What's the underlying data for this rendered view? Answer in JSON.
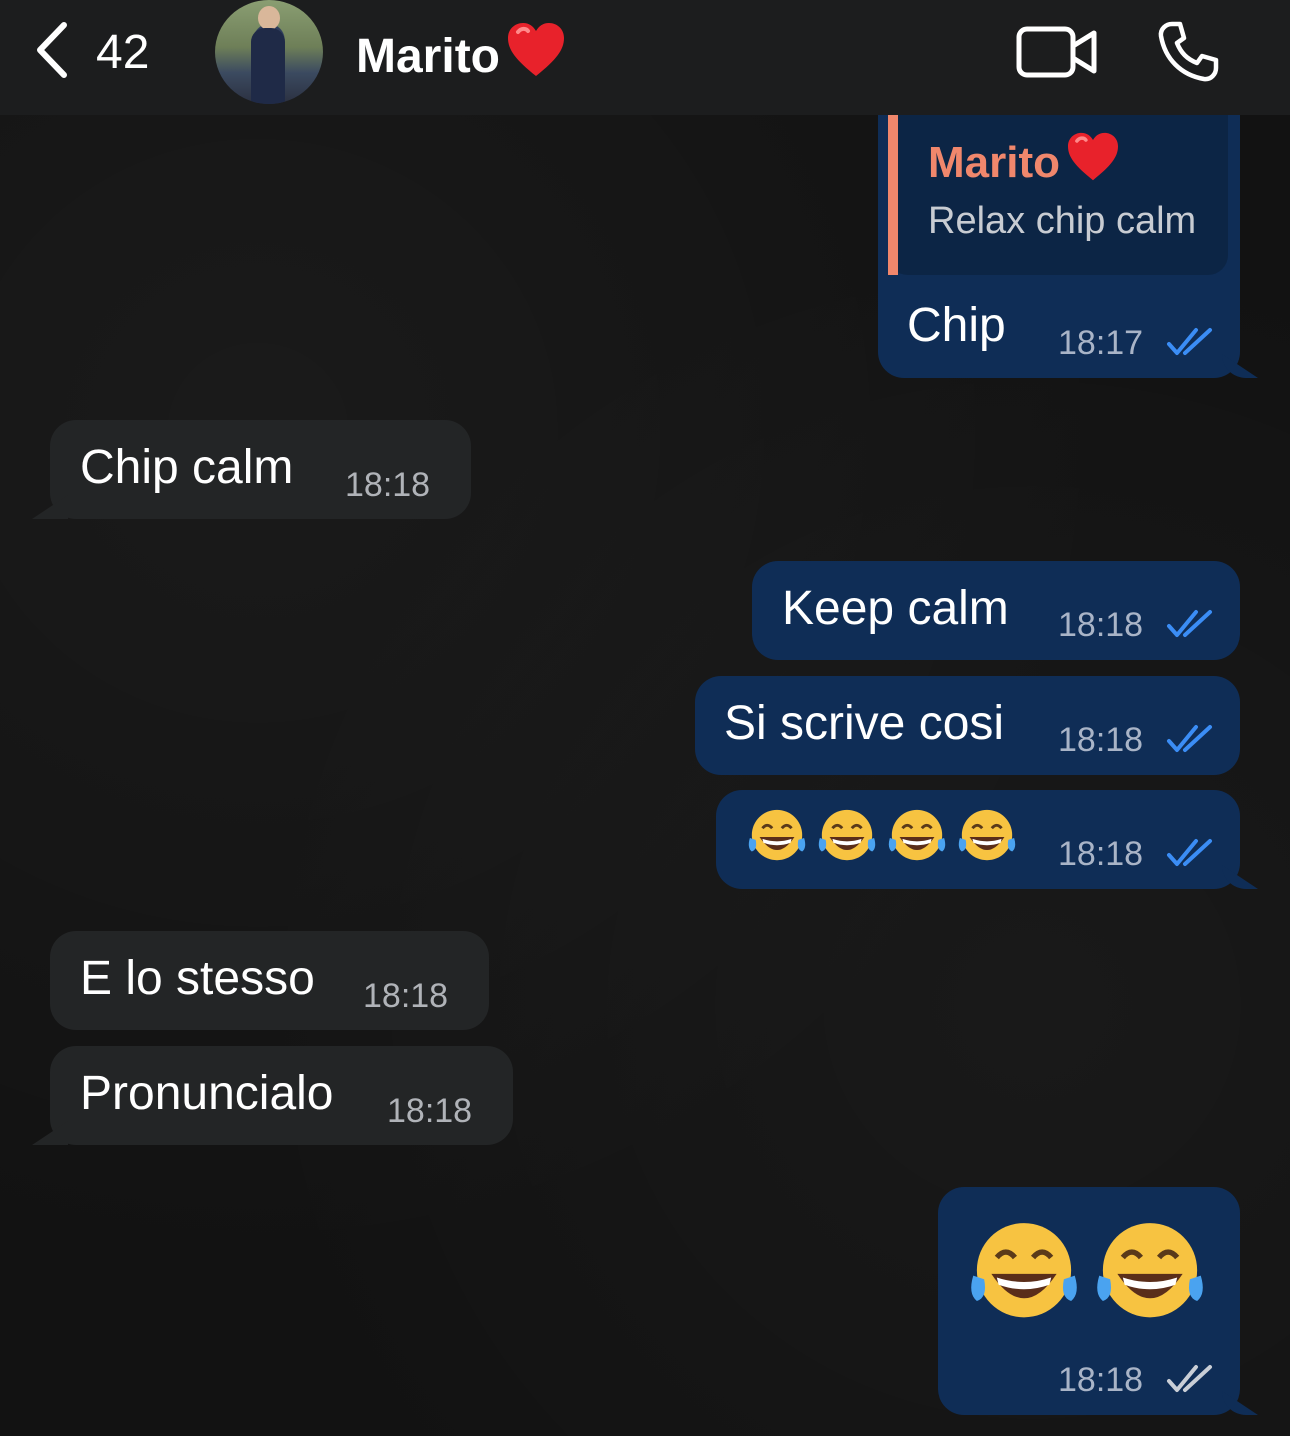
{
  "header": {
    "back_count": "42",
    "contact_name": "Marito"
  },
  "messages": [
    {
      "id": "m1",
      "direction": "out",
      "reply_author": "Marito",
      "reply_text": "Relax chip calm",
      "text": "Chip",
      "time": "18:17",
      "status": "read"
    },
    {
      "id": "m2",
      "direction": "in",
      "text": "Chip calm",
      "time": "18:18"
    },
    {
      "id": "m3",
      "direction": "out",
      "text": "Keep calm",
      "time": "18:18",
      "status": "read"
    },
    {
      "id": "m4",
      "direction": "out",
      "text": "Si scrive cosi",
      "time": "18:18",
      "status": "read"
    },
    {
      "id": "m5",
      "direction": "out",
      "emoji": "face-with-tears-of-joy",
      "emoji_count": 4,
      "time": "18:18",
      "status": "read"
    },
    {
      "id": "m6",
      "direction": "in",
      "text": "E lo stesso",
      "time": "18:18"
    },
    {
      "id": "m7",
      "direction": "in",
      "text": "Pronuncialo",
      "time": "18:18"
    },
    {
      "id": "m8",
      "direction": "out",
      "emoji": "face-with-tears-of-joy",
      "emoji_count": 2,
      "time": "18:18",
      "status": "delivered"
    }
  ],
  "colors": {
    "outgoing_bubble": "#0f2d56",
    "incoming_bubble": "#232526",
    "read_ticks": "#3b8df5",
    "delivered_ticks": "#c9ced6",
    "reply_accent": "#f0876c"
  },
  "icons": [
    "chevron-left-icon",
    "video-camera-icon",
    "phone-icon",
    "heart-emoji",
    "double-check-icon",
    "tears-of-joy-emoji"
  ]
}
